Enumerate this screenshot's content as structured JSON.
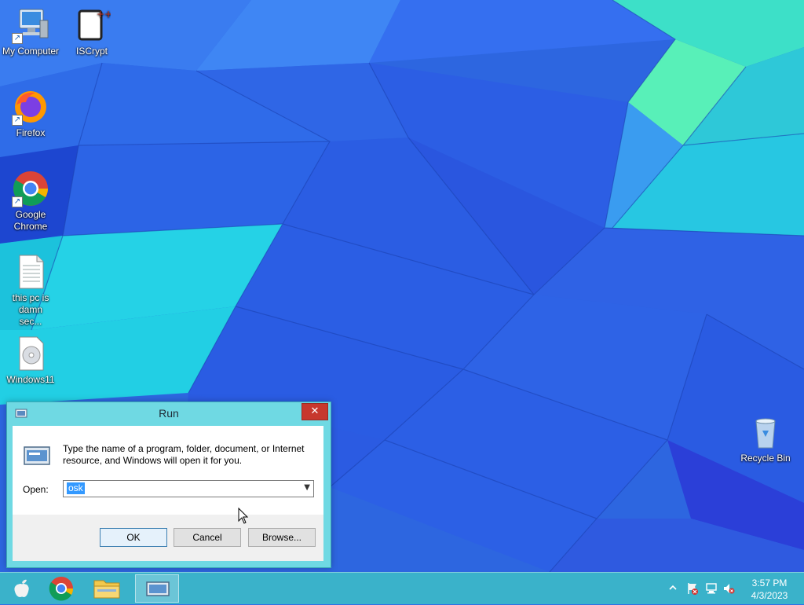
{
  "desktop": {
    "icons": [
      {
        "label": "My Computer",
        "icon": "computer-icon"
      },
      {
        "label": "ISCrypt",
        "icon": "iscrypt-icon"
      },
      {
        "label": "Firefox",
        "icon": "firefox-icon"
      },
      {
        "label": "Google Chrome",
        "icon": "chrome-icon"
      },
      {
        "label": "this pc is damn sec...",
        "icon": "text-file-icon"
      },
      {
        "label": "Windows11",
        "icon": "disc-image-icon"
      },
      {
        "label": "Recycle Bin",
        "icon": "recycle-bin-icon"
      }
    ]
  },
  "run_dialog": {
    "title": "Run",
    "close_glyph": "✕",
    "description": "Type the name of a program, folder, document, or Internet resource, and Windows will open it for you.",
    "open_label": "Open:",
    "open_value": "osk",
    "ok_label": "OK",
    "cancel_label": "Cancel",
    "browse_label": "Browse..."
  },
  "taskbar": {
    "items": [
      {
        "icon": "apple-start-icon"
      },
      {
        "icon": "chrome-icon"
      },
      {
        "icon": "file-explorer-icon"
      },
      {
        "icon": "run-app-icon",
        "active": true
      }
    ],
    "tray": {
      "icons": [
        "show-hidden-icons-chevron-icon",
        "action-center-flag-icon",
        "network-icon",
        "volume-muted-icon"
      ],
      "time": "3:57 PM",
      "date": "4/3/2023"
    }
  },
  "colors": {
    "taskbar": "#3cb9c8",
    "dialog_frame": "#6fd9e3",
    "close_button": "#c7382d",
    "selection": "#3399ff"
  }
}
